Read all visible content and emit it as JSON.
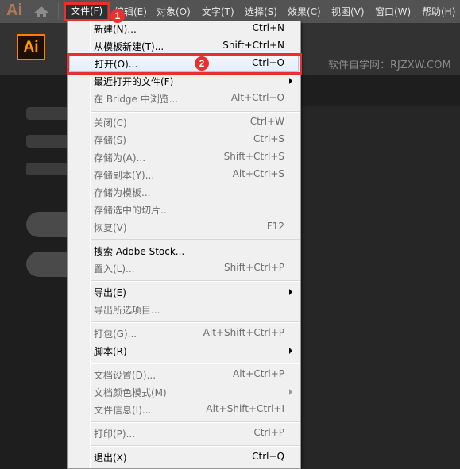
{
  "app": {
    "logo": "Ai",
    "badge_logo": "Ai",
    "watermark": "软件自学网：RJZXW.COM"
  },
  "menubar": {
    "items": [
      {
        "label": "文件(F)"
      },
      {
        "label": "编辑(E)"
      },
      {
        "label": "对象(O)"
      },
      {
        "label": "文字(T)"
      },
      {
        "label": "选择(S)"
      },
      {
        "label": "效果(C)"
      },
      {
        "label": "视图(V)"
      },
      {
        "label": "窗口(W)"
      },
      {
        "label": "帮助(H)"
      }
    ]
  },
  "file_menu": {
    "items": [
      {
        "label": "新建(N)...",
        "shortcut": "Ctrl+N"
      },
      {
        "label": "从模板新建(T)...",
        "shortcut": "Shift+Ctrl+N"
      },
      {
        "label": "打开(O)...",
        "shortcut": "Ctrl+O"
      },
      {
        "label": "最近打开的文件(F)",
        "shortcut": ""
      },
      {
        "label": "在 Bridge 中浏览...",
        "shortcut": "Alt+Ctrl+O"
      },
      {
        "label": "关闭(C)",
        "shortcut": "Ctrl+W"
      },
      {
        "label": "存储(S)",
        "shortcut": "Ctrl+S"
      },
      {
        "label": "存储为(A)...",
        "shortcut": "Shift+Ctrl+S"
      },
      {
        "label": "存储副本(Y)...",
        "shortcut": "Alt+Ctrl+S"
      },
      {
        "label": "存储为模板...",
        "shortcut": ""
      },
      {
        "label": "存储选中的切片...",
        "shortcut": ""
      },
      {
        "label": "恢复(V)",
        "shortcut": "F12"
      },
      {
        "label": "搜索 Adobe Stock...",
        "shortcut": ""
      },
      {
        "label": "置入(L)...",
        "shortcut": "Shift+Ctrl+P"
      },
      {
        "label": "导出(E)",
        "shortcut": ""
      },
      {
        "label": "导出所选项目...",
        "shortcut": ""
      },
      {
        "label": "打包(G)...",
        "shortcut": "Alt+Shift+Ctrl+P"
      },
      {
        "label": "脚本(R)",
        "shortcut": ""
      },
      {
        "label": "文档设置(D)...",
        "shortcut": "Alt+Ctrl+P"
      },
      {
        "label": "文档颜色模式(M)",
        "shortcut": ""
      },
      {
        "label": "文件信息(I)...",
        "shortcut": "Alt+Shift+Ctrl+I"
      },
      {
        "label": "打印(P)...",
        "shortcut": "Ctrl+P"
      },
      {
        "label": "退出(X)",
        "shortcut": "Ctrl+Q"
      }
    ]
  },
  "annotations": {
    "step1": "1",
    "step2": "2",
    "highlight_color": "#e8302f"
  }
}
